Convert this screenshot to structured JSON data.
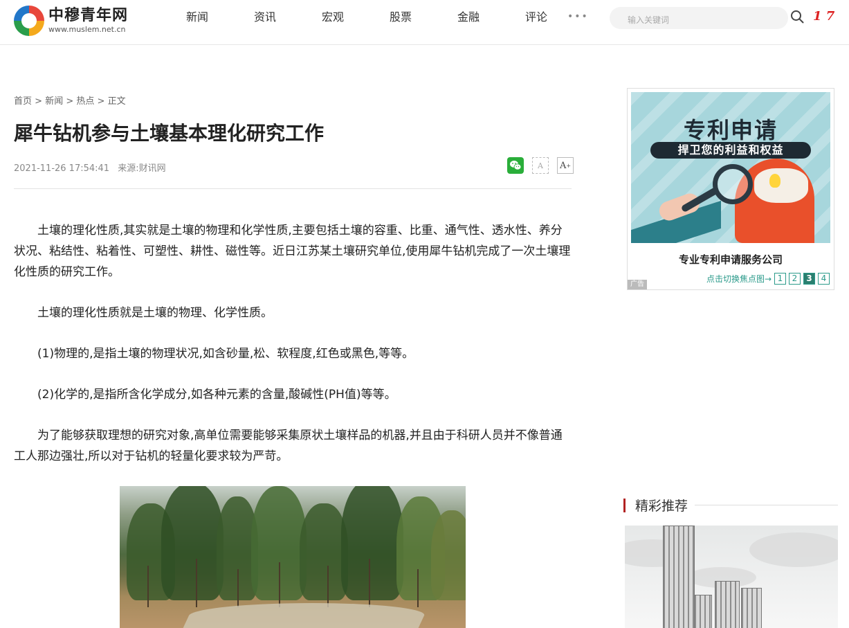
{
  "header": {
    "logo_name": "中穆青年网",
    "logo_url": "www.muslem.net.cn",
    "nav": [
      "新闻",
      "资讯",
      "宏观",
      "股票",
      "金融",
      "评论"
    ],
    "more": "•••",
    "search_placeholder": "输入关键词",
    "red_text": "1 7"
  },
  "breadcrumb": [
    "首页",
    "新闻",
    "热点",
    "正文"
  ],
  "breadcrumb_sep": " > ",
  "article": {
    "title": "犀牛钻机参与土壤基本理化研究工作",
    "datetime": "2021-11-26 17:54:41",
    "source_label": "来源:",
    "source": "财讯网",
    "paragraphs": [
      "土壤的理化性质,其实就是土壤的物理和化学性质,主要包括土壤的容重、比重、通气性、透水性、养分状况、粘结性、粘着性、可塑性、耕性、磁性等。近日江苏某土壤研究单位,使用犀牛钻机完成了一次土壤理化性质的研究工作。",
      "土壤的理化性质就是土壤的物理、化学性质。",
      "(1)物理的,是指土壤的物理状况,如含砂量,松、软程度,红色或黑色,等等。",
      "(2)化学的,是指所含化学成分,如各种元素的含量,酸碱性(PH值)等等。",
      "为了能够获取理想的研究对象,高单位需要能够采集原状土壤样品的机器,并且由于科研人员并不像普通工人那边强壮,所以对于钻机的轻量化要求较为严苛。"
    ],
    "font_small": "A",
    "font_large": "A",
    "font_large_sup": "+"
  },
  "ad": {
    "headline": "专利申请",
    "subline": "捍卫您的利益和权益",
    "caption": "专业专利申请服务公司",
    "switch_label": "点击切换焦点图→",
    "pages": [
      "1",
      "2",
      "3",
      "4"
    ],
    "active_page": 3,
    "tag": "广告"
  },
  "recommend": {
    "title": "精彩推荐"
  },
  "colors": {
    "accent_red": "#b22222",
    "accent_teal": "#2a9a8a",
    "wechat_green": "#2aae3a"
  }
}
